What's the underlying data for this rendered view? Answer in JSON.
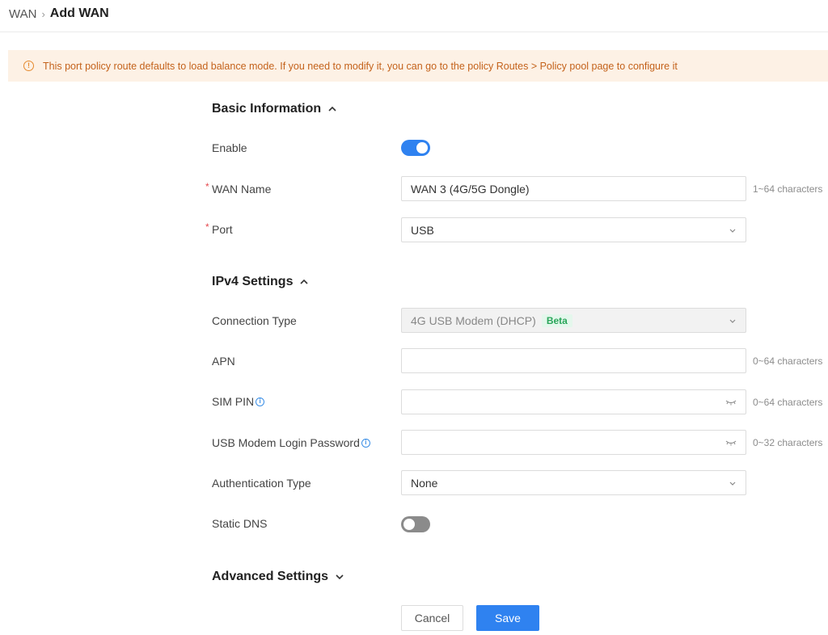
{
  "breadcrumb": {
    "root": "WAN",
    "current": "Add WAN"
  },
  "notice": {
    "text": "This port policy route defaults to load balance mode. If you need to modify it, you can go to the policy Routes > Policy pool page to configure it"
  },
  "basic": {
    "title": "Basic Information",
    "enable_label": "Enable",
    "enable_on": true,
    "wan_name_label": "WAN Name",
    "wan_name_value": "WAN 3 (4G/5G Dongle)",
    "wan_name_hint": "1~64 characters",
    "port_label": "Port",
    "port_value": "USB"
  },
  "ipv4": {
    "title": "IPv4 Settings",
    "conn_type_label": "Connection Type",
    "conn_type_value": "4G USB Modem (DHCP)",
    "conn_type_badge": "Beta",
    "apn_label": "APN",
    "apn_value": "",
    "apn_hint": "0~64 characters",
    "sim_pin_label": "SIM PIN",
    "sim_pin_hint": "0~64 characters",
    "usb_pwd_label": "USB Modem Login Password",
    "usb_pwd_hint": "0~32 characters",
    "auth_label": "Authentication Type",
    "auth_value": "None",
    "static_dns_label": "Static DNS",
    "static_dns_on": false
  },
  "advanced": {
    "title": "Advanced Settings"
  },
  "actions": {
    "cancel": "Cancel",
    "save": "Save"
  },
  "colors": {
    "accent": "#2f82f0",
    "warning": "#e58a2e",
    "required": "#e5484d",
    "beta": "#2aa55a"
  }
}
